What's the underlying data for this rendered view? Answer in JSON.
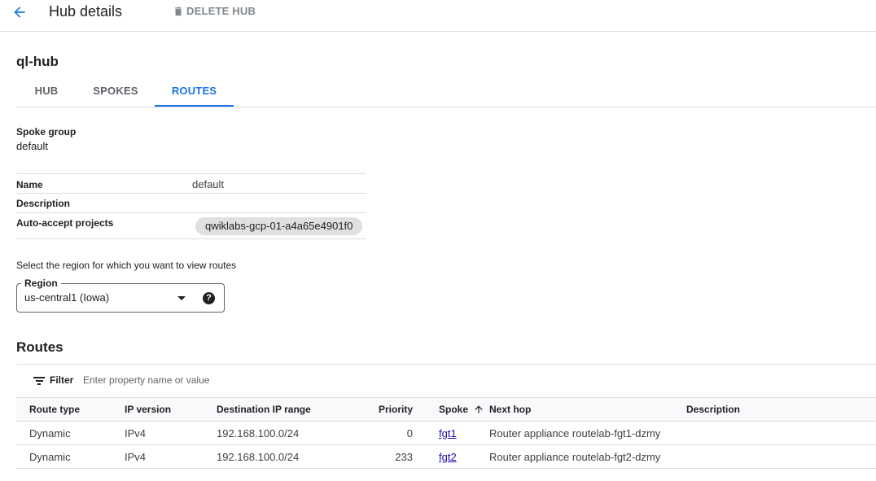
{
  "header": {
    "title": "Hub details",
    "delete_label": "DELETE HUB",
    "back_icon": "arrow-back-icon",
    "delete_icon": "trash-icon",
    "accent": "#1a73e8"
  },
  "hub": {
    "name": "ql-hub"
  },
  "tabs": [
    {
      "label": "HUB",
      "active": false
    },
    {
      "label": "SPOKES",
      "active": false
    },
    {
      "label": "ROUTES",
      "active": true
    }
  ],
  "spoke_group": {
    "label": "Spoke group",
    "value": "default"
  },
  "properties": {
    "name_label": "Name",
    "name_value": "default",
    "description_label": "Description",
    "description_value": "",
    "auto_accept_label": "Auto-accept projects",
    "auto_accept_value": "qwiklabs-gcp-01-a4a65e4901f0"
  },
  "region": {
    "hint": "Select the region for which you want to view routes",
    "label": "Region",
    "value": "us-central1 (Iowa)",
    "help_icon": "help-circle-icon"
  },
  "routes": {
    "title": "Routes",
    "filter_label": "Filter",
    "filter_placeholder": "Enter property name or value",
    "columns": {
      "route_type": "Route type",
      "ip_version": "IP version",
      "destination": "Destination IP range",
      "priority": "Priority",
      "spoke": "Spoke",
      "next_hop": "Next hop",
      "description": "Description"
    },
    "sort": "spoke-ascending",
    "rows": [
      {
        "route_type": "Dynamic",
        "ip_version": "IPv4",
        "destination": "192.168.100.0/24",
        "priority": "0",
        "spoke": "fgt1",
        "next_hop": "Router appliance routelab-fgt1-dzmy",
        "description": ""
      },
      {
        "route_type": "Dynamic",
        "ip_version": "IPv4",
        "destination": "192.168.100.0/24",
        "priority": "233",
        "spoke": "fgt2",
        "next_hop": "Router appliance routelab-fgt2-dzmy",
        "description": ""
      }
    ]
  }
}
